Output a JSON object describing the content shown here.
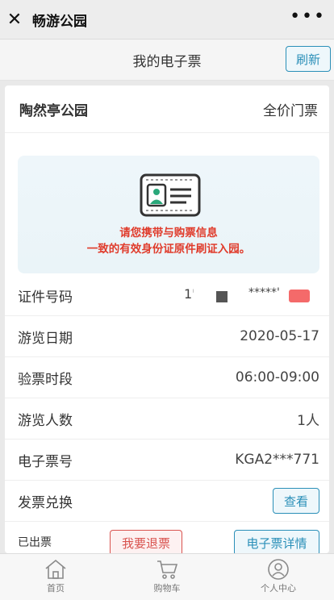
{
  "app": {
    "title": "畅游公园"
  },
  "subheader": {
    "title": "我的电子票",
    "refresh_label": "刷新"
  },
  "ticket": {
    "park_name": "陶然亭公园",
    "ticket_type": "全价门票",
    "notice_line1": "请您携带与购票信息",
    "notice_line2": "一致的有效身份证原件刷证入园。",
    "rows": {
      "id": {
        "label": "证件号码",
        "value_prefix": "1'",
        "value_masked": "*****'"
      },
      "date": {
        "label": "游览日期",
        "value": "2020-05-17"
      },
      "slot": {
        "label": "验票时段",
        "value": "06:00-09:00"
      },
      "count": {
        "label": "游览人数",
        "value": "1人"
      },
      "eticket": {
        "label": "电子票号",
        "value": "KGA2***771"
      },
      "invoice": {
        "label": "发票兑换",
        "button": "查看"
      }
    },
    "status": "已出票",
    "refund_label": "我要退票",
    "detail_label": "电子票详情"
  },
  "tabbar": [
    {
      "label": "首页",
      "icon": "home-icon"
    },
    {
      "label": "购物车",
      "icon": "cart-icon"
    },
    {
      "label": "个人中心",
      "icon": "user-icon"
    }
  ]
}
